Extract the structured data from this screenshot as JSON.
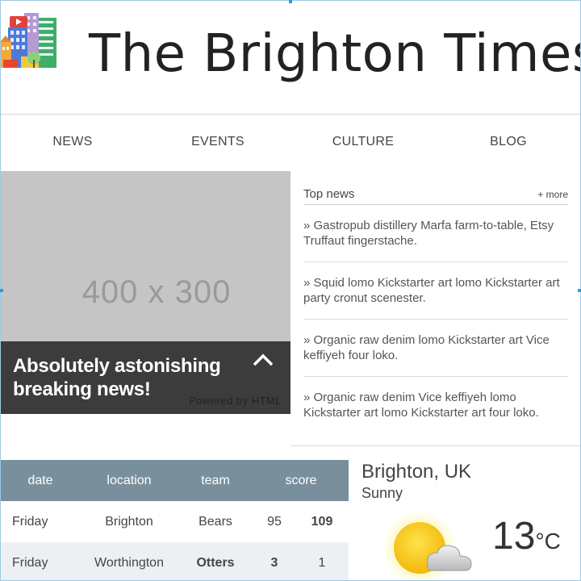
{
  "site": {
    "title": "The Brighton Times",
    "logo_icon": "city-buildings-icon"
  },
  "nav": {
    "items": [
      "NEWS",
      "EVENTS",
      "CULTURE",
      "BLOG"
    ]
  },
  "hero": {
    "placeholder": "400 x 300",
    "headline": "Absolutely astonishing breaking news!",
    "powered_by": "Powered by HTML",
    "toggle_icon": "chevron-up-icon"
  },
  "top_news": {
    "title": "Top news",
    "more": "+ more",
    "items": [
      "» Gastropub distillery Marfa farm-to-table, Etsy Truffaut fingerstache.",
      "» Squid lomo Kickstarter art lomo Kickstarter art party cronut scenester.",
      "» Organic raw denim lomo Kickstarter art Vice keffiyeh four loko.",
      "» Organic raw denim Vice keffiyeh lomo Kickstarter art lomo Kickstarter art four loko."
    ]
  },
  "scores": {
    "headers": [
      "date",
      "location",
      "team",
      "score"
    ],
    "rows": [
      {
        "date": "Friday",
        "location": "Brighton",
        "team": "Bears",
        "score_a": "95",
        "score_b": "109"
      },
      {
        "date": "Friday",
        "location": "Worthington",
        "team": "Otters",
        "score_a": "3",
        "score_b": "1"
      }
    ]
  },
  "weather": {
    "city": "Brighton, UK",
    "condition": "Sunny",
    "temperature": "13",
    "unit": "°C",
    "icon": "sun-cloud-icon"
  },
  "colors": {
    "table_header": "#79909c",
    "hero_caption": "#3c3c3c",
    "placeholder_bg": "#c5c5c5",
    "selection_handle": "#2a9fd8"
  }
}
